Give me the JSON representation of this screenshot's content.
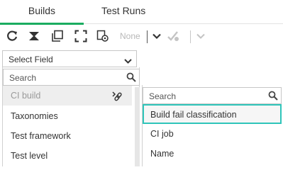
{
  "tabs": [
    {
      "label": "Builds",
      "active": true
    },
    {
      "label": "Test Runs",
      "active": false
    }
  ],
  "toolbar": {
    "icons": [
      "refresh-icon",
      "filter-icon",
      "copy-icon",
      "expand-icon",
      "settings-icon",
      "checkmark-icon",
      "chevron-down-icon"
    ],
    "none_label": "None"
  },
  "select_field": {
    "label": "Select Field"
  },
  "field_list": {
    "search_placeholder": "Search",
    "items": [
      "CI build",
      "Taxonomies",
      "Test framework",
      "Test level"
    ],
    "selected_index": 0
  },
  "sub_list": {
    "search_placeholder": "Search",
    "items": [
      "Build fail classification",
      "CI job",
      "Name"
    ],
    "highlighted_index": 0
  },
  "colors": {
    "accent": "#1aac60",
    "highlight": "#2fc5ba"
  }
}
